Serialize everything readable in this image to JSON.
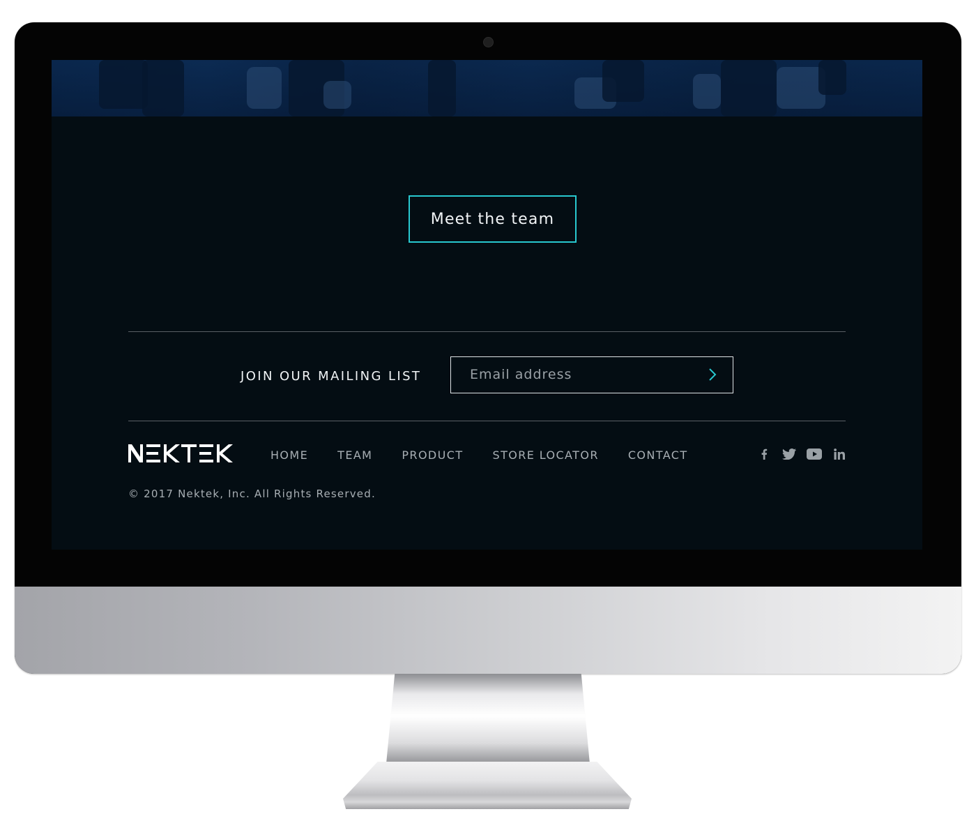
{
  "cta": {
    "label": "Meet the team"
  },
  "mailing": {
    "label": "JOIN OUR MAILING LIST",
    "placeholder": "Email address",
    "submit_icon": "chevron-right-icon"
  },
  "footer": {
    "logo_text": "NEKTEK",
    "nav": [
      {
        "label": "HOME"
      },
      {
        "label": "TEAM"
      },
      {
        "label": "PRODUCT"
      },
      {
        "label": "STORE LOCATOR"
      },
      {
        "label": "CONTACT"
      }
    ],
    "social": [
      "facebook-icon",
      "twitter-icon",
      "youtube-icon",
      "linkedin-icon"
    ],
    "copyright": "© 2017 Nektek, Inc. All Rights Reserved."
  },
  "colors": {
    "accent": "#28c8cf",
    "screen_bg": "#040d13",
    "text_primary": "#f1f4f6",
    "text_muted": "#a8afb4"
  }
}
